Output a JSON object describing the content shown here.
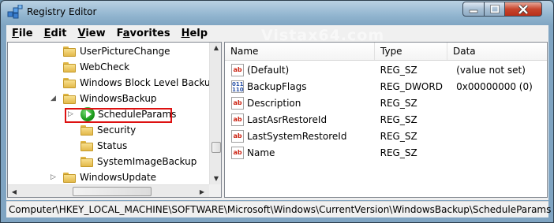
{
  "window": {
    "title": "Registry Editor",
    "watermark": "Vistax64.com"
  },
  "menu": {
    "items": [
      {
        "key": "F",
        "rest": "ile"
      },
      {
        "key": "E",
        "rest": "dit"
      },
      {
        "key": "V",
        "rest": "iew"
      },
      {
        "key": "",
        "pre": "F",
        "mid": "a",
        "rest": "vorites"
      },
      {
        "key": "H",
        "rest": "elp"
      }
    ],
    "file": "File",
    "edit": "Edit",
    "view": "View",
    "favorites": "Favorites",
    "help": "Help"
  },
  "tree": {
    "items": [
      {
        "label": "UserPictureChange",
        "level": 3
      },
      {
        "label": "WebCheck",
        "level": 3
      },
      {
        "label": "Windows Block Level Backup",
        "level": 3
      },
      {
        "label": "WindowsBackup",
        "level": 3,
        "expanded": true
      },
      {
        "label": "ScheduleParams",
        "level": 4,
        "selected": true
      },
      {
        "label": "Security",
        "level": 4
      },
      {
        "label": "Status",
        "level": 4
      },
      {
        "label": "SystemImageBackup",
        "level": 4
      },
      {
        "label": "WindowsUpdate",
        "level": 3
      }
    ]
  },
  "list": {
    "columns": [
      "Name",
      "Type",
      "Data"
    ],
    "rows": [
      {
        "name": "(Default)",
        "type": "REG_SZ",
        "data": "(value not set)",
        "icon": "string-value-icon"
      },
      {
        "name": "BackupFlags",
        "type": "REG_DWORD",
        "data": "0x00000000 (0)",
        "icon": "binary-value-icon"
      },
      {
        "name": "Description",
        "type": "REG_SZ",
        "data": "",
        "icon": "string-value-icon"
      },
      {
        "name": "LastAsrRestoreId",
        "type": "REG_SZ",
        "data": "",
        "icon": "string-value-icon"
      },
      {
        "name": "LastSystemRestoreId",
        "type": "REG_SZ",
        "data": "",
        "icon": "string-value-icon"
      },
      {
        "name": "Name",
        "type": "REG_SZ",
        "data": "",
        "icon": "string-value-icon"
      }
    ],
    "string_icon_text": "ab",
    "binary_icon_text": "011\n110"
  },
  "status": {
    "path": "Computer\\HKEY_LOCAL_MACHINE\\SOFTWARE\\Microsoft\\Windows\\CurrentVersion\\WindowsBackup\\ScheduleParams"
  },
  "colors": {
    "selection_border": "#dd1111",
    "title_bar": "#8fb3ce",
    "close_button": "#c8452d"
  }
}
